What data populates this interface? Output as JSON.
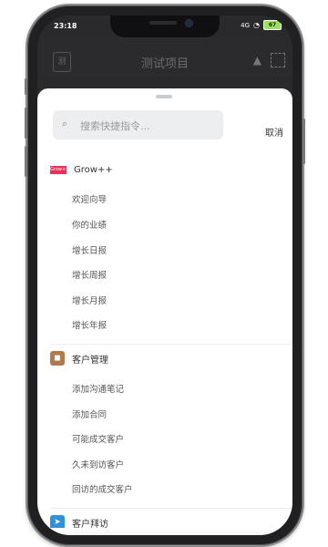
{
  "status": {
    "time": "23:18",
    "signal": "4G",
    "battery": "67"
  },
  "appbar": {
    "title": "测试项目",
    "left_icon": "测"
  },
  "search": {
    "placeholder": "搜索快捷指令...",
    "cancel_label": "取消"
  },
  "sections": [
    {
      "title": "Grow++",
      "logo_text": "Grow++",
      "icon": "grow-logo-icon",
      "items": [
        "欢迎向导",
        "你的业绩",
        "增长日报",
        "增长周报",
        "增长月报",
        "增长年报"
      ]
    },
    {
      "title": "客户管理",
      "icon": "customer-management-icon",
      "color": "#b07a4d",
      "items": [
        "添加沟通笔记",
        "添加合同",
        "可能成交客户",
        "久未到访客户",
        "回访的成交客户"
      ]
    },
    {
      "title": "客户拜访",
      "icon": "paper-plane-icon",
      "color": "#2f8fd8",
      "items": []
    }
  ]
}
